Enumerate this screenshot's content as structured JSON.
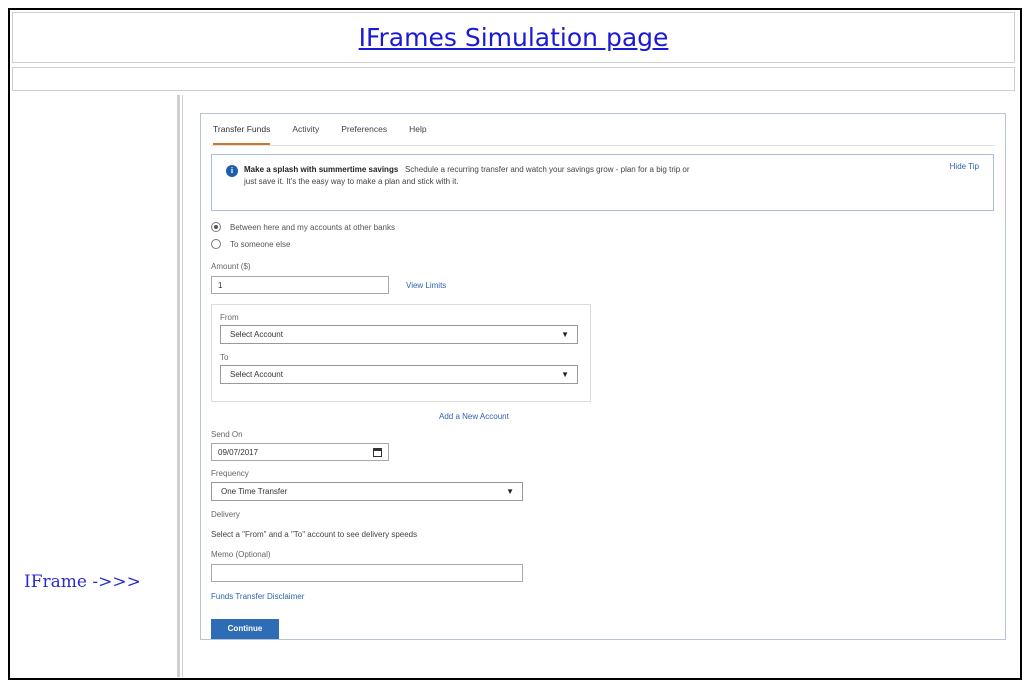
{
  "page": {
    "title": "IFrames Simulation page",
    "iframe_label": "IFrame ->>>"
  },
  "tabs": [
    {
      "label": "Transfer Funds",
      "active": true
    },
    {
      "label": "Activity"
    },
    {
      "label": "Preferences"
    },
    {
      "label": "Help"
    }
  ],
  "tip": {
    "heading": "Make a splash with summertime savings",
    "body": "Schedule a recurring transfer and watch your savings grow - plan for a big trip or just save it. It's the easy way to make a plan and stick with it.",
    "hide_label": "Hide Tip"
  },
  "transfer_type": {
    "options": [
      {
        "label": "Between here and my accounts at other banks",
        "checked": true
      },
      {
        "label": "To someone else",
        "checked": false
      }
    ]
  },
  "amount": {
    "label": "Amount ($)",
    "value": "1",
    "view_limits": "View Limits"
  },
  "accounts": {
    "from_label": "From",
    "from_value": "Select Account",
    "to_label": "To",
    "to_value": "Select Account",
    "add_account": "Add a New Account"
  },
  "send_on": {
    "label": "Send On",
    "value": "09/07/2017"
  },
  "frequency": {
    "label": "Frequency",
    "value": "One Time Transfer"
  },
  "delivery": {
    "label": "Delivery",
    "text": "Select a \"From\" and a \"To\" account to see delivery speeds"
  },
  "memo": {
    "label": "Memo (Optional)",
    "value": ""
  },
  "disclaimer": "Funds Transfer Disclaimer",
  "continue_label": "Continue",
  "colors": {
    "title_link": "#1a1ad6",
    "primary_button": "#2e6db6",
    "link": "#2e63b0",
    "active_tab_underline": "#c8792b",
    "tip_border": "#a9bedb"
  }
}
